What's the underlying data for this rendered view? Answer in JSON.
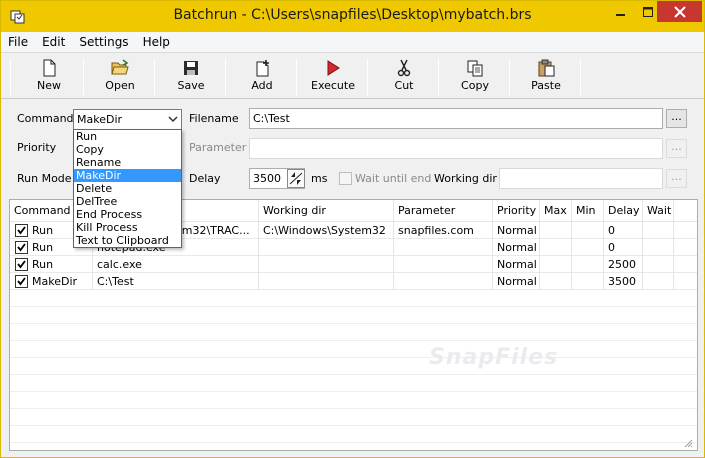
{
  "window": {
    "title": "Batchrun - C:\\Users\\snapfiles\\Desktop\\mybatch.brs",
    "accent": "#f0c800",
    "close_color": "#c7372f"
  },
  "menu": [
    "File",
    "Edit",
    "Settings",
    "Help"
  ],
  "toolbar": [
    {
      "label": "New",
      "icon": "new-document-icon"
    },
    {
      "label": "Open",
      "icon": "open-folder-icon"
    },
    {
      "label": "Save",
      "icon": "save-disk-icon"
    },
    {
      "label": "Add",
      "icon": "add-document-icon"
    },
    {
      "label": "Execute",
      "icon": "execute-play-icon"
    },
    {
      "label": "Cut",
      "icon": "scissors-icon"
    },
    {
      "label": "Copy",
      "icon": "copy-icon"
    },
    {
      "label": "Paste",
      "icon": "paste-clipboard-icon"
    }
  ],
  "form": {
    "command_label": "Command",
    "command_value": "MakeDir",
    "filename_label": "Filename",
    "filename_value": "C:\\Test",
    "priority_label": "Priority",
    "parameter_label": "Parameter",
    "parameter_value": "",
    "runmode_label": "Run Mode",
    "delay_label": "Delay",
    "delay_value": "3500",
    "delay_unit": "ms",
    "wait_label": "Wait until end",
    "workdir_label": "Working dir",
    "workdir_value": "",
    "browse_label": "..."
  },
  "dropdown": {
    "options": [
      "Run",
      "Copy",
      "Rename",
      "MakeDir",
      "Delete",
      "DelTree",
      "End Process",
      "Kill Process",
      "Text to Clipboard"
    ],
    "selected": "MakeDir"
  },
  "grid": {
    "columns": [
      "Command",
      "",
      "Working dir",
      "Parameter",
      "Priority",
      "Max",
      "Min",
      "Delay",
      "Wait"
    ],
    "rows": [
      {
        "checked": true,
        "command": "Run",
        "file": "em32\\TRAC...",
        "workdir": "C:\\Windows\\System32",
        "parameter": "snapfiles.com",
        "priority": "Normal",
        "delay": "0"
      },
      {
        "checked": true,
        "command": "Run",
        "file": "notepad.exe",
        "workdir": "",
        "parameter": "",
        "priority": "Normal",
        "delay": "0"
      },
      {
        "checked": true,
        "command": "Run",
        "file": "calc.exe",
        "workdir": "",
        "parameter": "",
        "priority": "Normal",
        "delay": "2500"
      },
      {
        "checked": true,
        "command": "MakeDir",
        "file": "C:\\Test",
        "workdir": "",
        "parameter": "",
        "priority": "Normal",
        "delay": "3500"
      }
    ]
  },
  "watermark": "SnapFiles"
}
